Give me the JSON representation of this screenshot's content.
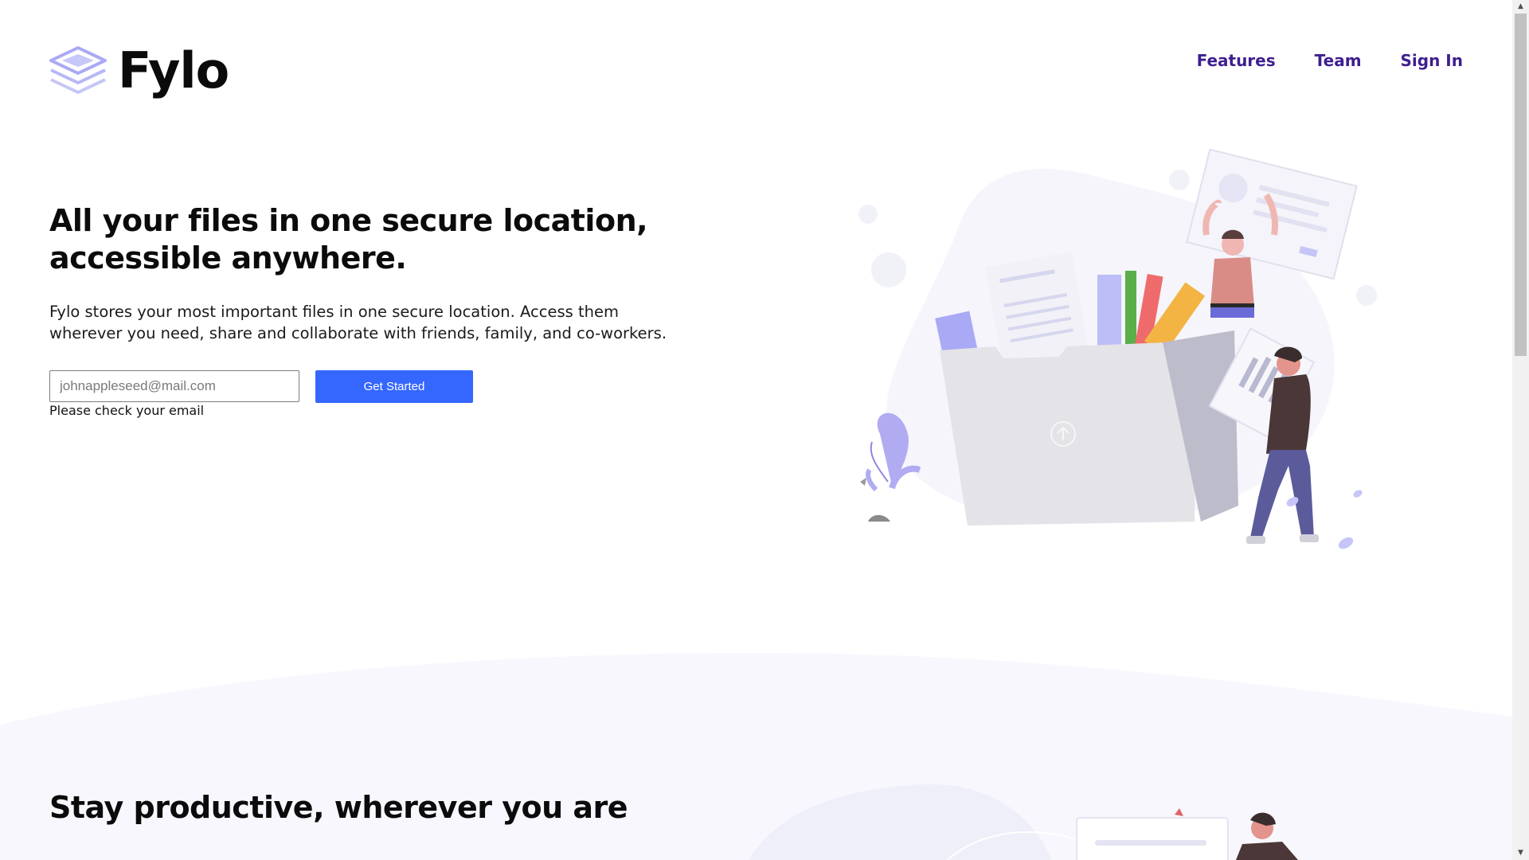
{
  "brand": {
    "name": "Fylo",
    "logo_icon": "stacked-layers-icon"
  },
  "nav": {
    "items": [
      "Features",
      "Team",
      "Sign In"
    ]
  },
  "hero": {
    "title": "All your files in one secure location, accessible anywhere.",
    "description": "Fylo stores your most important files in one secure location. Access them wherever you need, share and collaborate with friends, family, and co-workers.",
    "email_placeholder": "johnappleseed@mail.com",
    "email_value": "",
    "cta_label": "Get Started",
    "error_message": "Please check your email"
  },
  "section2": {
    "title": "Stay productive, wherever you are"
  },
  "colors": {
    "nav_link": "#3e1f8f",
    "cta_background": "#3567ff",
    "logo_light": "#c5c6f7",
    "logo_dark": "#9b9bf0",
    "section_background": "#f7f7fd"
  },
  "icons": {
    "illustration": "file-sharing-illustration",
    "scroll_up": "triangle-up-icon",
    "scroll_down": "triangle-down-icon"
  }
}
